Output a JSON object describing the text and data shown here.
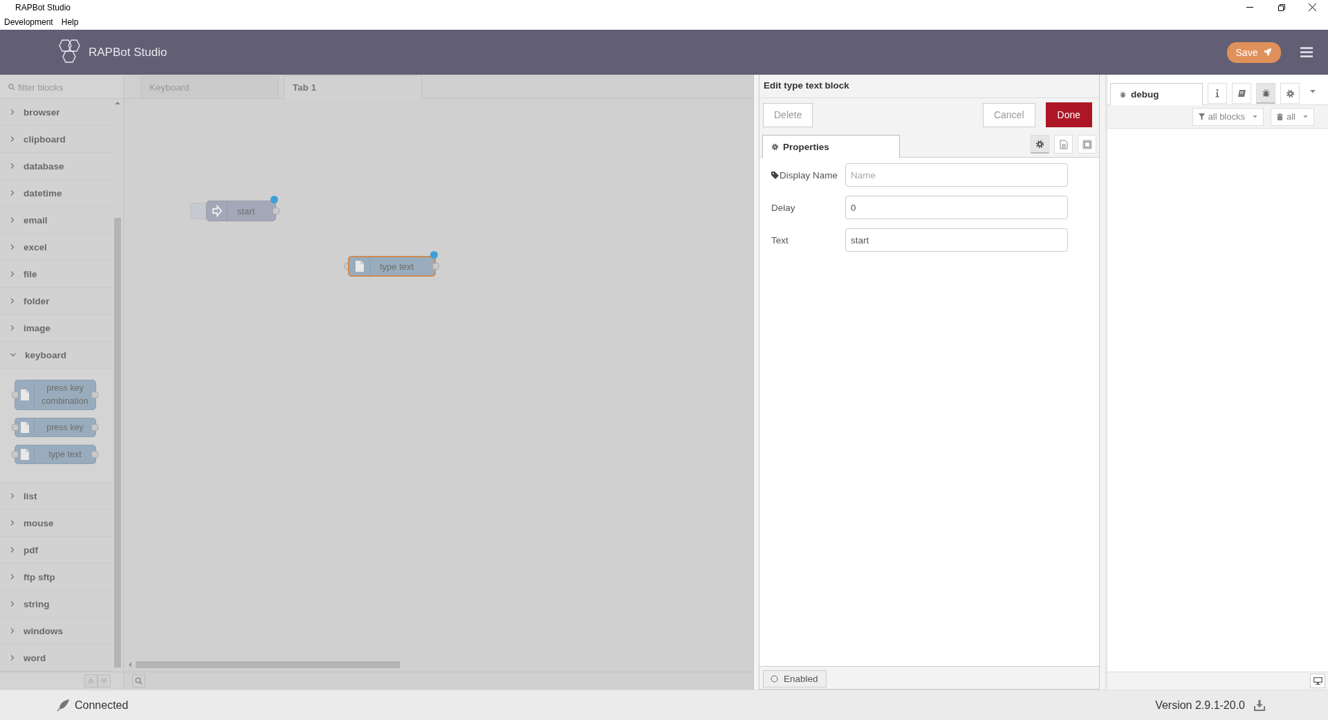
{
  "window": {
    "title": "RAPBot Studio"
  },
  "menu_bar": [
    {
      "label": "Development"
    },
    {
      "label": "Help"
    }
  ],
  "header": {
    "title": "RAPBot Studio",
    "save_button": "Save"
  },
  "palette": {
    "search": {
      "placeholder": "filter blocks"
    },
    "categories": [
      {
        "label": "browser",
        "expanded": false
      },
      {
        "label": "clipboard",
        "expanded": false
      },
      {
        "label": "database",
        "expanded": false
      },
      {
        "label": "datetime",
        "expanded": false
      },
      {
        "label": "email",
        "expanded": false
      },
      {
        "label": "excel",
        "expanded": false
      },
      {
        "label": "file",
        "expanded": false
      },
      {
        "label": "folder",
        "expanded": false
      },
      {
        "label": "image",
        "expanded": false
      },
      {
        "label": "keyboard",
        "expanded": true,
        "blocks": [
          {
            "label": "press key combination"
          },
          {
            "label": "press key"
          },
          {
            "label": "type text"
          }
        ]
      },
      {
        "label": "list",
        "expanded": false
      },
      {
        "label": "mouse",
        "expanded": false
      },
      {
        "label": "pdf",
        "expanded": false
      },
      {
        "label": "ftp sftp",
        "expanded": false
      },
      {
        "label": "string",
        "expanded": false
      },
      {
        "label": "windows",
        "expanded": false
      },
      {
        "label": "word",
        "expanded": false
      }
    ]
  },
  "workspace": {
    "tabs": [
      {
        "label": "Keyboard",
        "selected": false
      },
      {
        "label": "Tab 1",
        "selected": true
      }
    ],
    "nodes": [
      {
        "kind": "inject",
        "label": "start",
        "selected": false,
        "changed": true
      },
      {
        "kind": "action",
        "label": "type text",
        "selected": true,
        "changed": true
      }
    ]
  },
  "editor": {
    "title": "Edit type text block",
    "buttons": [
      {
        "label": "Delete",
        "kind": "plain"
      },
      {
        "label": "Cancel",
        "kind": "plain"
      },
      {
        "label": "Done",
        "kind": "primary"
      }
    ],
    "tabs": [
      {
        "label": "Properties",
        "selected": true
      }
    ],
    "tool_tabs": [
      {
        "kind": "settings",
        "selected": true
      },
      {
        "kind": "description",
        "selected": false
      },
      {
        "kind": "appearance",
        "selected": false
      }
    ],
    "fields": [
      {
        "label": "Display Name",
        "kind": "tagged",
        "placeholder": "Name"
      },
      {
        "label": "Delay",
        "kind": "plain",
        "value": "0"
      },
      {
        "label": "Text",
        "kind": "plain",
        "value": "start"
      }
    ],
    "enabled_button": "Enabled"
  },
  "sidebar": {
    "tabs": [
      {
        "label": "debug",
        "selected": true
      }
    ],
    "tool_buttons": [
      {
        "kind": "info",
        "selected": false
      },
      {
        "kind": "book",
        "selected": false
      },
      {
        "kind": "bug",
        "selected": true
      },
      {
        "kind": "settings",
        "selected": false
      }
    ],
    "filters": [
      {
        "kind": "filter",
        "label": "all blocks"
      },
      {
        "kind": "clear",
        "label": "all"
      }
    ]
  },
  "status_bar": {
    "connection": "Connected",
    "version": "Version 2.9.1-20.0"
  }
}
